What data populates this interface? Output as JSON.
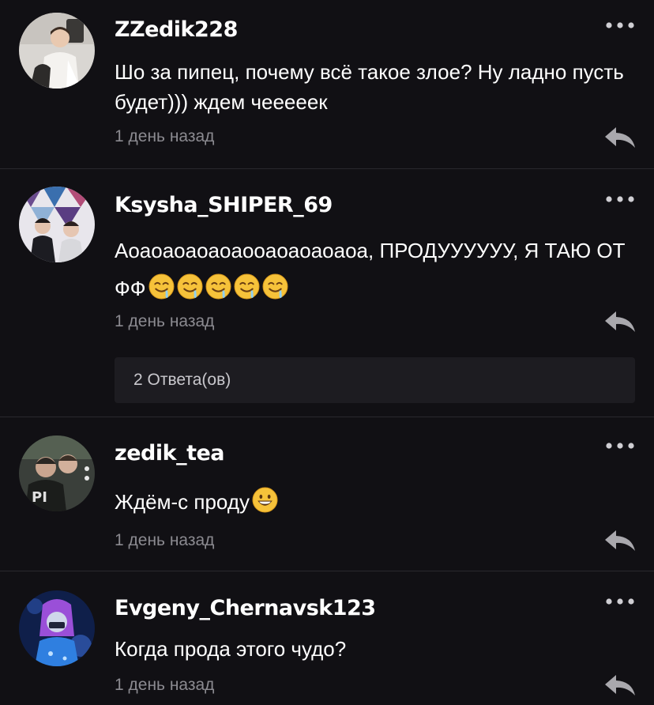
{
  "comments": [
    {
      "username": "ZZedik228",
      "text": "Шо за пипец, почему всё такое злое? Ну ладно пусть будет))) ждем чееееек",
      "time": "1 день назад",
      "emoji_count": 0
    },
    {
      "username": "Ksysha_SHIPER_69",
      "text": "Аоаоаоаоаоаооаоаоаоаоа, ПРОДУУУУУУ, Я ТАЮ ОТ ФФ",
      "time": "1 день назад",
      "emoji": "drooling-face-emoji",
      "emoji_count": 5,
      "replies_label": "2 Ответа(ов)"
    },
    {
      "username": "zedik_tea",
      "text": "Ждём-с проду",
      "time": "1 день назад",
      "emoji": "grinning-face-emoji",
      "emoji_count": 1
    },
    {
      "username": "Evgeny_Chernavsk123",
      "text": "Когда прода этого чудо?",
      "time": "1 день назад",
      "emoji_count": 0
    }
  ],
  "icons": {
    "more": "more-dots-icon",
    "reply": "reply-arrow-icon"
  },
  "colors": {
    "background": "#111014",
    "text": "#ffffff",
    "muted": "#8b8a90",
    "divider": "#2a292e",
    "replies_box": "#1d1c21"
  }
}
